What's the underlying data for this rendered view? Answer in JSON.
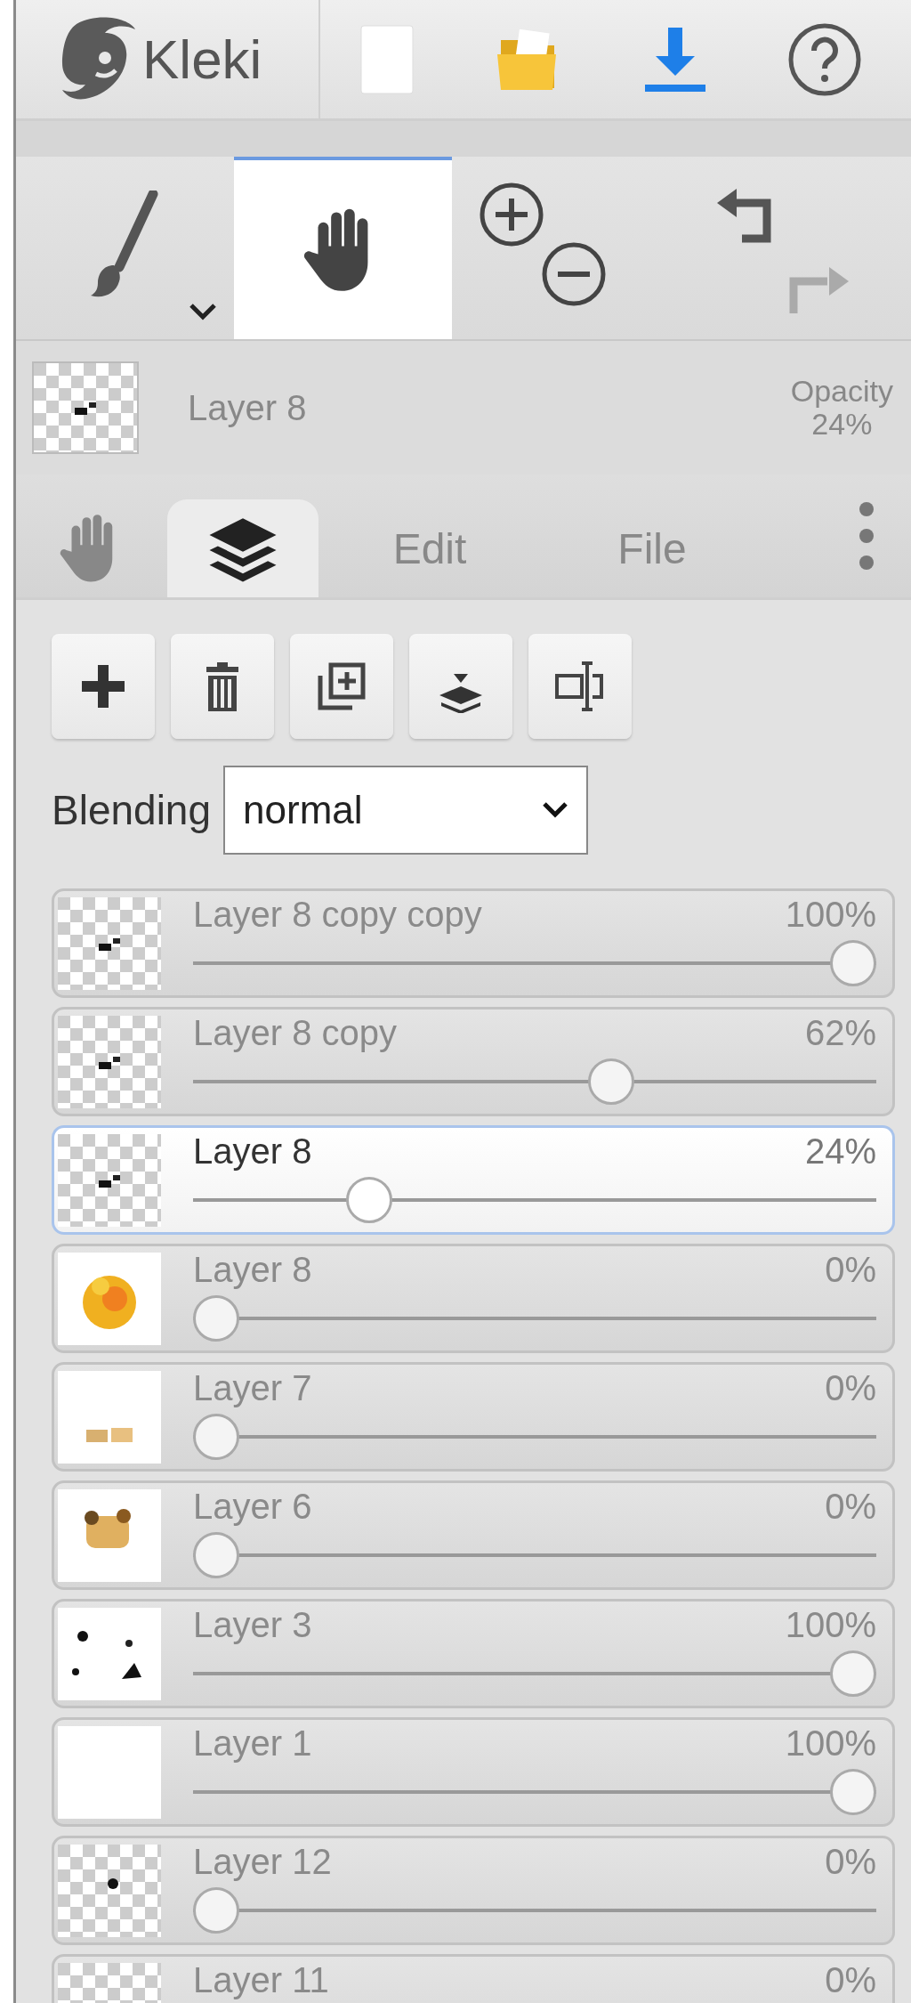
{
  "topbar": {
    "logo": "Kleki"
  },
  "tools": [
    {
      "kind": "brush",
      "selected": false
    },
    {
      "kind": "hand",
      "selected": true
    }
  ],
  "history": [
    {
      "kind": "undo",
      "disabled": false
    },
    {
      "kind": "redo",
      "disabled": true
    }
  ],
  "current_layer": {
    "name": "Layer 8",
    "opacity_label": "Opacity",
    "opacity": "24%"
  },
  "tabs": [
    {
      "kind": "hand",
      "selected": false
    },
    {
      "kind": "layers",
      "selected": true
    },
    {
      "kind": "text",
      "label": "Edit",
      "selected": false
    },
    {
      "kind": "text",
      "label": "File",
      "selected": false
    }
  ],
  "blending": {
    "label": "Blending",
    "value": "normal"
  },
  "layers": [
    {
      "name": "Layer 8 copy copy",
      "opacity": "100%",
      "level": 1,
      "selected": false
    },
    {
      "name": "Layer 8 copy",
      "opacity": "62%",
      "level": 0.62,
      "selected": false
    },
    {
      "name": "Layer 8",
      "opacity": "24%",
      "level": 0.24,
      "selected": true
    },
    {
      "name": "Layer 8",
      "opacity": "0%",
      "level": 0,
      "selected": false
    },
    {
      "name": "Layer 7",
      "opacity": "0%",
      "level": 0,
      "selected": false
    },
    {
      "name": "Layer 6",
      "opacity": "0%",
      "level": 0,
      "selected": false
    },
    {
      "name": "Layer 3",
      "opacity": "100%",
      "level": 1,
      "selected": false
    },
    {
      "name": "Layer 1",
      "opacity": "100%",
      "level": 1,
      "selected": false
    },
    {
      "name": "Layer 12",
      "opacity": "0%",
      "level": 0,
      "selected": false
    },
    {
      "name": "Layer 11",
      "opacity": "0%",
      "selected": false
    }
  ]
}
